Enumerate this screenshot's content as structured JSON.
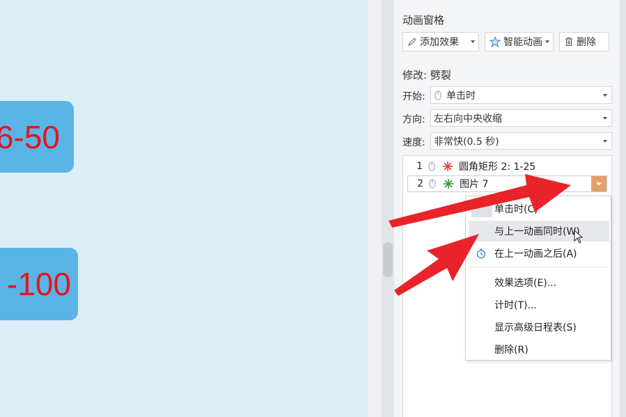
{
  "canvas": {
    "shapes": [
      {
        "text": "6-50"
      },
      {
        "text": "-100"
      }
    ]
  },
  "panel": {
    "title": "动画窗格",
    "toolbar": {
      "add_effect": "添加效果",
      "smart_animation": "智能动画",
      "delete": "删除"
    },
    "modify_label": "修改: 劈裂",
    "start": {
      "label": "开始:",
      "value": "单击时"
    },
    "direction": {
      "label": "方向:",
      "value": "左右向中央收缩"
    },
    "speed": {
      "label": "速度:",
      "value": "非常快(0.5 秒)"
    },
    "animations": [
      {
        "num": "1",
        "name": "圆角矩形 2: 1-25",
        "fx_color": "#e0443c"
      },
      {
        "num": "2",
        "name": "图片 7",
        "fx_color": "#2f9a3f"
      }
    ]
  },
  "context_menu": {
    "items": [
      {
        "label": "单击时(C)"
      },
      {
        "label": "与上一动画同时(W)"
      },
      {
        "label": "在上一动画之后(A)"
      },
      {
        "label": "效果选项(E)..."
      },
      {
        "label": "计时(T)..."
      },
      {
        "label": "显示高级日程表(S)"
      },
      {
        "label": "删除(R)"
      }
    ]
  },
  "colors": {
    "slide_bg": "#dcedf8",
    "shape_fill": "#5ab4e5",
    "shape_text": "#e8141b",
    "arrow": "#e8242a",
    "dropdown_accent": "#e3a067"
  }
}
